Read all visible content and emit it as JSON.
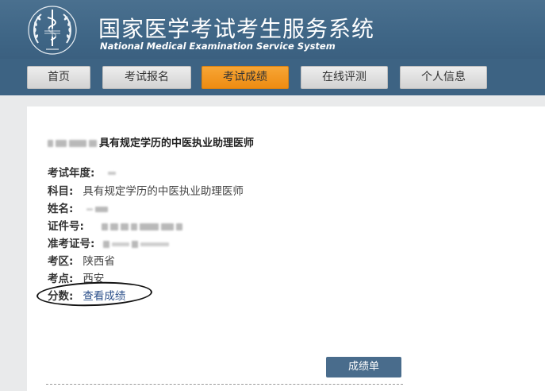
{
  "header": {
    "title_cn": "国家医学考试考生服务系统",
    "title_en": "National Medical Examination Service System",
    "emblem_icon": "caduceus-emblem-icon"
  },
  "nav": {
    "items": [
      {
        "label": "首页"
      },
      {
        "label": "考试报名"
      },
      {
        "label": "考试成绩",
        "active": true
      },
      {
        "label": "在线评测"
      },
      {
        "label": "个人信息"
      }
    ]
  },
  "card": {
    "title": "具有规定学历的中医执业助理医师"
  },
  "fields": {
    "year_label": "考试年度:",
    "subject_label": "科目:",
    "subject_value": "具有规定学历的中医执业助理医师",
    "name_label": "姓名:",
    "id_label": "证件号:",
    "ticket_label": "准考证号:",
    "region_label": "考区:",
    "region_value": "陕西省",
    "site_label": "考点:",
    "site_value": "西安",
    "score_label": "分数:",
    "score_link": "查看成绩"
  },
  "actions": {
    "report_button": "成绩单"
  },
  "colors": {
    "header_bg": "#3f6686",
    "active_tab": "#ee8c12",
    "link": "#2b4f8a",
    "report_button_bg": "#496c8c"
  }
}
